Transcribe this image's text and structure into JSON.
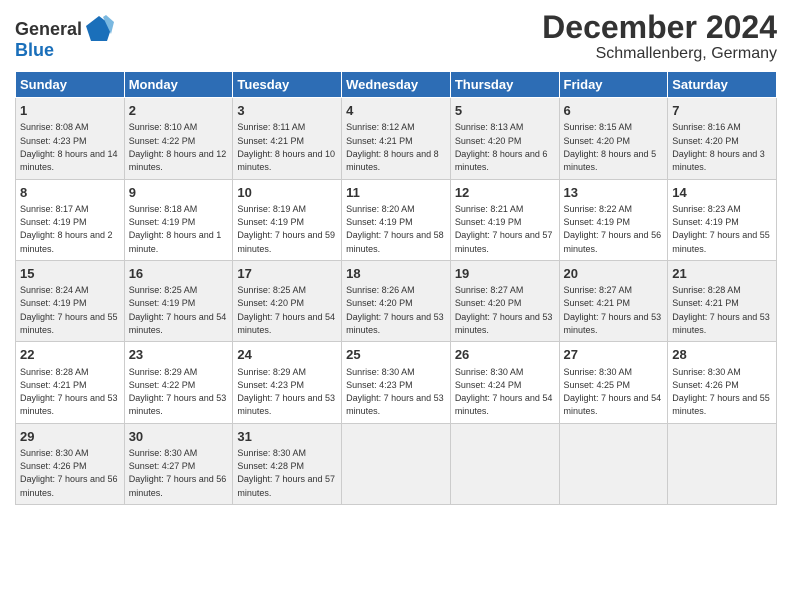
{
  "header": {
    "logo_general": "General",
    "logo_blue": "Blue",
    "title": "December 2024",
    "subtitle": "Schmallenberg, Germany"
  },
  "columns": [
    "Sunday",
    "Monday",
    "Tuesday",
    "Wednesday",
    "Thursday",
    "Friday",
    "Saturday"
  ],
  "weeks": [
    [
      {
        "day": "1",
        "sunrise": "Sunrise: 8:08 AM",
        "sunset": "Sunset: 4:23 PM",
        "daylight": "Daylight: 8 hours and 14 minutes."
      },
      {
        "day": "2",
        "sunrise": "Sunrise: 8:10 AM",
        "sunset": "Sunset: 4:22 PM",
        "daylight": "Daylight: 8 hours and 12 minutes."
      },
      {
        "day": "3",
        "sunrise": "Sunrise: 8:11 AM",
        "sunset": "Sunset: 4:21 PM",
        "daylight": "Daylight: 8 hours and 10 minutes."
      },
      {
        "day": "4",
        "sunrise": "Sunrise: 8:12 AM",
        "sunset": "Sunset: 4:21 PM",
        "daylight": "Daylight: 8 hours and 8 minutes."
      },
      {
        "day": "5",
        "sunrise": "Sunrise: 8:13 AM",
        "sunset": "Sunset: 4:20 PM",
        "daylight": "Daylight: 8 hours and 6 minutes."
      },
      {
        "day": "6",
        "sunrise": "Sunrise: 8:15 AM",
        "sunset": "Sunset: 4:20 PM",
        "daylight": "Daylight: 8 hours and 5 minutes."
      },
      {
        "day": "7",
        "sunrise": "Sunrise: 8:16 AM",
        "sunset": "Sunset: 4:20 PM",
        "daylight": "Daylight: 8 hours and 3 minutes."
      }
    ],
    [
      {
        "day": "8",
        "sunrise": "Sunrise: 8:17 AM",
        "sunset": "Sunset: 4:19 PM",
        "daylight": "Daylight: 8 hours and 2 minutes."
      },
      {
        "day": "9",
        "sunrise": "Sunrise: 8:18 AM",
        "sunset": "Sunset: 4:19 PM",
        "daylight": "Daylight: 8 hours and 1 minute."
      },
      {
        "day": "10",
        "sunrise": "Sunrise: 8:19 AM",
        "sunset": "Sunset: 4:19 PM",
        "daylight": "Daylight: 7 hours and 59 minutes."
      },
      {
        "day": "11",
        "sunrise": "Sunrise: 8:20 AM",
        "sunset": "Sunset: 4:19 PM",
        "daylight": "Daylight: 7 hours and 58 minutes."
      },
      {
        "day": "12",
        "sunrise": "Sunrise: 8:21 AM",
        "sunset": "Sunset: 4:19 PM",
        "daylight": "Daylight: 7 hours and 57 minutes."
      },
      {
        "day": "13",
        "sunrise": "Sunrise: 8:22 AM",
        "sunset": "Sunset: 4:19 PM",
        "daylight": "Daylight: 7 hours and 56 minutes."
      },
      {
        "day": "14",
        "sunrise": "Sunrise: 8:23 AM",
        "sunset": "Sunset: 4:19 PM",
        "daylight": "Daylight: 7 hours and 55 minutes."
      }
    ],
    [
      {
        "day": "15",
        "sunrise": "Sunrise: 8:24 AM",
        "sunset": "Sunset: 4:19 PM",
        "daylight": "Daylight: 7 hours and 55 minutes."
      },
      {
        "day": "16",
        "sunrise": "Sunrise: 8:25 AM",
        "sunset": "Sunset: 4:19 PM",
        "daylight": "Daylight: 7 hours and 54 minutes."
      },
      {
        "day": "17",
        "sunrise": "Sunrise: 8:25 AM",
        "sunset": "Sunset: 4:20 PM",
        "daylight": "Daylight: 7 hours and 54 minutes."
      },
      {
        "day": "18",
        "sunrise": "Sunrise: 8:26 AM",
        "sunset": "Sunset: 4:20 PM",
        "daylight": "Daylight: 7 hours and 53 minutes."
      },
      {
        "day": "19",
        "sunrise": "Sunrise: 8:27 AM",
        "sunset": "Sunset: 4:20 PM",
        "daylight": "Daylight: 7 hours and 53 minutes."
      },
      {
        "day": "20",
        "sunrise": "Sunrise: 8:27 AM",
        "sunset": "Sunset: 4:21 PM",
        "daylight": "Daylight: 7 hours and 53 minutes."
      },
      {
        "day": "21",
        "sunrise": "Sunrise: 8:28 AM",
        "sunset": "Sunset: 4:21 PM",
        "daylight": "Daylight: 7 hours and 53 minutes."
      }
    ],
    [
      {
        "day": "22",
        "sunrise": "Sunrise: 8:28 AM",
        "sunset": "Sunset: 4:21 PM",
        "daylight": "Daylight: 7 hours and 53 minutes."
      },
      {
        "day": "23",
        "sunrise": "Sunrise: 8:29 AM",
        "sunset": "Sunset: 4:22 PM",
        "daylight": "Daylight: 7 hours and 53 minutes."
      },
      {
        "day": "24",
        "sunrise": "Sunrise: 8:29 AM",
        "sunset": "Sunset: 4:23 PM",
        "daylight": "Daylight: 7 hours and 53 minutes."
      },
      {
        "day": "25",
        "sunrise": "Sunrise: 8:30 AM",
        "sunset": "Sunset: 4:23 PM",
        "daylight": "Daylight: 7 hours and 53 minutes."
      },
      {
        "day": "26",
        "sunrise": "Sunrise: 8:30 AM",
        "sunset": "Sunset: 4:24 PM",
        "daylight": "Daylight: 7 hours and 54 minutes."
      },
      {
        "day": "27",
        "sunrise": "Sunrise: 8:30 AM",
        "sunset": "Sunset: 4:25 PM",
        "daylight": "Daylight: 7 hours and 54 minutes."
      },
      {
        "day": "28",
        "sunrise": "Sunrise: 8:30 AM",
        "sunset": "Sunset: 4:26 PM",
        "daylight": "Daylight: 7 hours and 55 minutes."
      }
    ],
    [
      {
        "day": "29",
        "sunrise": "Sunrise: 8:30 AM",
        "sunset": "Sunset: 4:26 PM",
        "daylight": "Daylight: 7 hours and 56 minutes."
      },
      {
        "day": "30",
        "sunrise": "Sunrise: 8:30 AM",
        "sunset": "Sunset: 4:27 PM",
        "daylight": "Daylight: 7 hours and 56 minutes."
      },
      {
        "day": "31",
        "sunrise": "Sunrise: 8:30 AM",
        "sunset": "Sunset: 4:28 PM",
        "daylight": "Daylight: 7 hours and 57 minutes."
      },
      {
        "day": "",
        "sunrise": "",
        "sunset": "",
        "daylight": ""
      },
      {
        "day": "",
        "sunrise": "",
        "sunset": "",
        "daylight": ""
      },
      {
        "day": "",
        "sunrise": "",
        "sunset": "",
        "daylight": ""
      },
      {
        "day": "",
        "sunrise": "",
        "sunset": "",
        "daylight": ""
      }
    ]
  ]
}
